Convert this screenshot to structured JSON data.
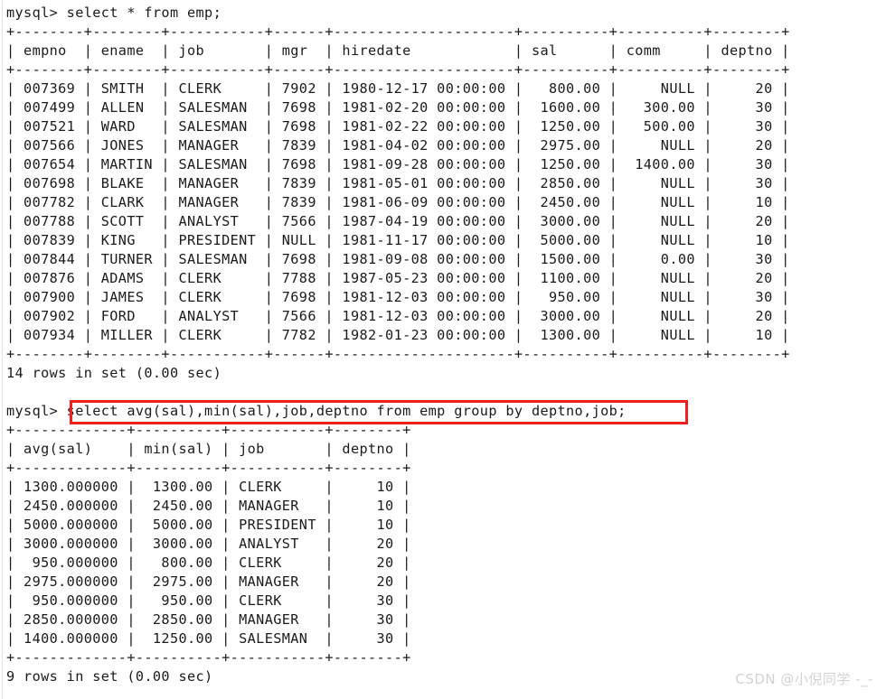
{
  "terminal": {
    "prompt": "mysql> ",
    "colors": {
      "background": "#ffffff",
      "text": "#1b1b1b",
      "highlight_box": "#f02020",
      "watermark": "#d2d2d2"
    }
  },
  "watermark": {
    "text": "CSDN @小倪同学 -_-"
  },
  "query1": {
    "command": "select * from emp;",
    "status": "14 rows in set (0.00 sec)",
    "table": {
      "separator": "+--------+--------+-----------+------+---------------------+----------+----------+--------+",
      "columns": [
        "empno",
        "ename",
        "job",
        "mgr",
        "hiredate",
        "sal",
        "comm",
        "deptno"
      ],
      "rows": [
        [
          "007369",
          "SMITH",
          "CLERK",
          "7902",
          "1980-12-17 00:00:00",
          "800.00",
          "NULL",
          "20"
        ],
        [
          "007499",
          "ALLEN",
          "SALESMAN",
          "7698",
          "1981-02-20 00:00:00",
          "1600.00",
          "300.00",
          "30"
        ],
        [
          "007521",
          "WARD",
          "SALESMAN",
          "7698",
          "1981-02-22 00:00:00",
          "1250.00",
          "500.00",
          "30"
        ],
        [
          "007566",
          "JONES",
          "MANAGER",
          "7839",
          "1981-04-02 00:00:00",
          "2975.00",
          "NULL",
          "20"
        ],
        [
          "007654",
          "MARTIN",
          "SALESMAN",
          "7698",
          "1981-09-28 00:00:00",
          "1250.00",
          "1400.00",
          "30"
        ],
        [
          "007698",
          "BLAKE",
          "MANAGER",
          "7839",
          "1981-05-01 00:00:00",
          "2850.00",
          "NULL",
          "30"
        ],
        [
          "007782",
          "CLARK",
          "MANAGER",
          "7839",
          "1981-06-09 00:00:00",
          "2450.00",
          "NULL",
          "10"
        ],
        [
          "007788",
          "SCOTT",
          "ANALYST",
          "7566",
          "1987-04-19 00:00:00",
          "3000.00",
          "NULL",
          "20"
        ],
        [
          "007839",
          "KING",
          "PRESIDENT",
          "NULL",
          "1981-11-17 00:00:00",
          "5000.00",
          "NULL",
          "10"
        ],
        [
          "007844",
          "TURNER",
          "SALESMAN",
          "7698",
          "1981-09-08 00:00:00",
          "1500.00",
          "0.00",
          "30"
        ],
        [
          "007876",
          "ADAMS",
          "CLERK",
          "7788",
          "1987-05-23 00:00:00",
          "1100.00",
          "NULL",
          "20"
        ],
        [
          "007900",
          "JAMES",
          "CLERK",
          "7698",
          "1981-12-03 00:00:00",
          "950.00",
          "NULL",
          "30"
        ],
        [
          "007902",
          "FORD",
          "ANALYST",
          "7566",
          "1981-12-03 00:00:00",
          "3000.00",
          "NULL",
          "20"
        ],
        [
          "007934",
          "MILLER",
          "CLERK",
          "7782",
          "1982-01-23 00:00:00",
          "1300.00",
          "NULL",
          "10"
        ]
      ]
    },
    "rendered": [
      "mysql> select * from emp;",
      "+--------+--------+-----------+------+---------------------+----------+----------+--------+",
      "| empno  | ename  | job       | mgr  | hiredate            | sal      | comm     | deptno |",
      "+--------+--------+-----------+------+---------------------+----------+----------+--------+",
      "| 007369 | SMITH  | CLERK     | 7902 | 1980-12-17 00:00:00 |   800.00 |     NULL |     20 |",
      "| 007499 | ALLEN  | SALESMAN  | 7698 | 1981-02-20 00:00:00 |  1600.00 |   300.00 |     30 |",
      "| 007521 | WARD   | SALESMAN  | 7698 | 1981-02-22 00:00:00 |  1250.00 |   500.00 |     30 |",
      "| 007566 | JONES  | MANAGER   | 7839 | 1981-04-02 00:00:00 |  2975.00 |     NULL |     20 |",
      "| 007654 | MARTIN | SALESMAN  | 7698 | 1981-09-28 00:00:00 |  1250.00 |  1400.00 |     30 |",
      "| 007698 | BLAKE  | MANAGER   | 7839 | 1981-05-01 00:00:00 |  2850.00 |     NULL |     30 |",
      "| 007782 | CLARK  | MANAGER   | 7839 | 1981-06-09 00:00:00 |  2450.00 |     NULL |     10 |",
      "| 007788 | SCOTT  | ANALYST   | 7566 | 1987-04-19 00:00:00 |  3000.00 |     NULL |     20 |",
      "| 007839 | KING   | PRESIDENT | NULL | 1981-11-17 00:00:00 |  5000.00 |     NULL |     10 |",
      "| 007844 | TURNER | SALESMAN  | 7698 | 1981-09-08 00:00:00 |  1500.00 |     0.00 |     30 |",
      "| 007876 | ADAMS  | CLERK     | 7788 | 1987-05-23 00:00:00 |  1100.00 |     NULL |     20 |",
      "| 007900 | JAMES  | CLERK     | 7698 | 1981-12-03 00:00:00 |   950.00 |     NULL |     30 |",
      "| 007902 | FORD   | ANALYST   | 7566 | 1981-12-03 00:00:00 |  3000.00 |     NULL |     20 |",
      "| 007934 | MILLER | CLERK     | 7782 | 1982-01-23 00:00:00 |  1300.00 |     NULL |     10 |",
      "+--------+--------+-----------+------+---------------------+----------+----------+--------+",
      "14 rows in set (0.00 sec)"
    ]
  },
  "query2": {
    "command": "select avg(sal),min(sal),job,deptno from emp group by deptno,job;",
    "highlighted": true,
    "status": "9 rows in set (0.00 sec)",
    "table": {
      "separator": "+-------------+----------+-----------+--------+",
      "columns": [
        "avg(sal)",
        "min(sal)",
        "job",
        "deptno"
      ],
      "rows": [
        [
          "1300.000000",
          "1300.00",
          "CLERK",
          "10"
        ],
        [
          "2450.000000",
          "2450.00",
          "MANAGER",
          "10"
        ],
        [
          "5000.000000",
          "5000.00",
          "PRESIDENT",
          "10"
        ],
        [
          "3000.000000",
          "3000.00",
          "ANALYST",
          "20"
        ],
        [
          "950.000000",
          "800.00",
          "CLERK",
          "20"
        ],
        [
          "2975.000000",
          "2975.00",
          "MANAGER",
          "20"
        ],
        [
          "950.000000",
          "950.00",
          "CLERK",
          "30"
        ],
        [
          "2850.000000",
          "2850.00",
          "MANAGER",
          "30"
        ],
        [
          "1400.000000",
          "1250.00",
          "SALESMAN",
          "30"
        ]
      ]
    },
    "rendered_prefix": "mysql> ",
    "rendered": [
      "+-------------+----------+-----------+--------+",
      "| avg(sal)    | min(sal) | job       | deptno |",
      "+-------------+----------+-----------+--------+",
      "| 1300.000000 |  1300.00 | CLERK     |     10 |",
      "| 2450.000000 |  2450.00 | MANAGER   |     10 |",
      "| 5000.000000 |  5000.00 | PRESIDENT |     10 |",
      "| 3000.000000 |  3000.00 | ANALYST   |     20 |",
      "|  950.000000 |   800.00 | CLERK     |     20 |",
      "| 2975.000000 |  2975.00 | MANAGER   |     20 |",
      "|  950.000000 |   950.00 | CLERK     |     30 |",
      "| 2850.000000 |  2850.00 | MANAGER   |     30 |",
      "| 1400.000000 |  1250.00 | SALESMAN  |     30 |",
      "+-------------+----------+-----------+--------+",
      "9 rows in set (0.00 sec)"
    ]
  }
}
